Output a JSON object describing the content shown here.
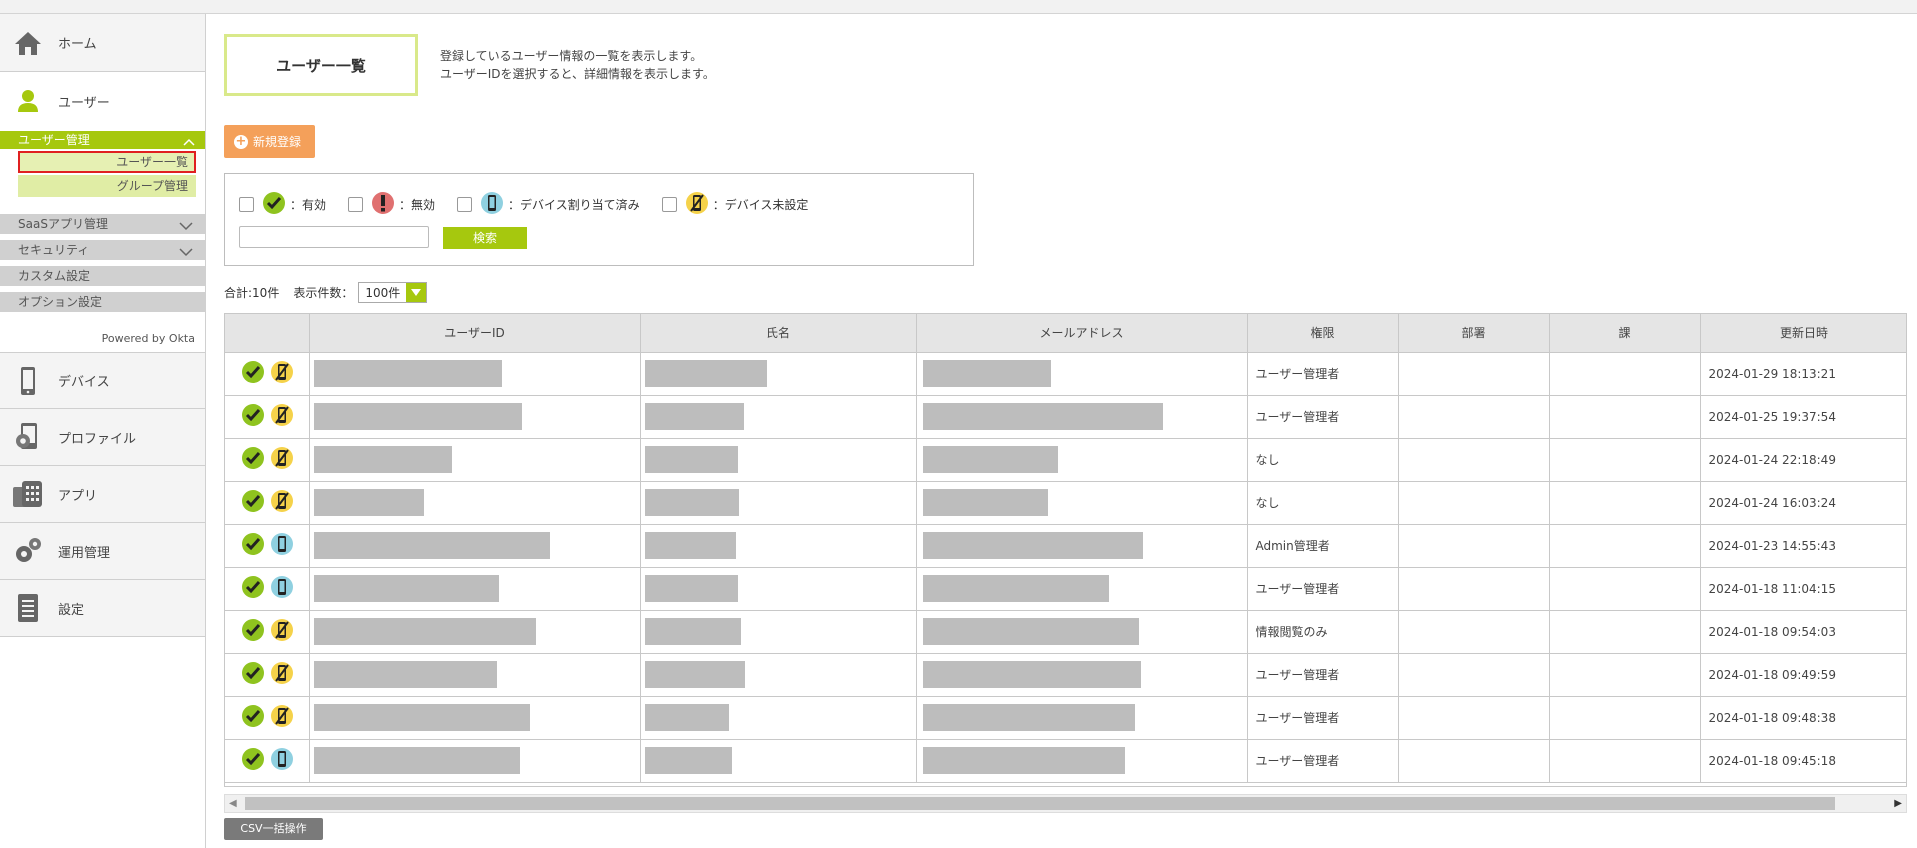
{
  "sidebar": {
    "home": "ホーム",
    "user": "ユーザー",
    "user_mgmt": "ユーザー管理",
    "user_list": "ユーザー一覧",
    "group_mgmt": "グループ管理",
    "saas": "SaaSアプリ管理",
    "security": "セキュリティ",
    "custom": "カスタム設定",
    "option": "オプション設定",
    "powered": "Powered by Okta",
    "device": "デバイス",
    "profile": "プロファイル",
    "app": "アプリ",
    "ops": "運用管理",
    "settings": "設定"
  },
  "header": {
    "title": "ユーザー一覧",
    "desc1": "登録しているユーザー情報の一覧を表示します。",
    "desc2": "ユーザーIDを選択すると、詳細情報を表示します。"
  },
  "new_button": "新規登録",
  "filters": {
    "active": "：有効",
    "inactive": "：無効",
    "assigned": "：デバイス割り当て済み",
    "unassigned": "：デバイス未設定",
    "search": "検索"
  },
  "summary": {
    "total": "合計:10件",
    "per_page_label": "表示件数：",
    "per_page": "100件"
  },
  "table": {
    "headers": [
      "",
      "ユーザーID",
      "氏名",
      "メールアドレス",
      "権限",
      "部署",
      "課",
      "更新日時"
    ],
    "rows": [
      {
        "device": "unassigned",
        "role": "ユーザー管理者",
        "updated": "2024-01-29 18:13:21"
      },
      {
        "device": "unassigned",
        "role": "ユーザー管理者",
        "updated": "2024-01-25 19:37:54"
      },
      {
        "device": "unassigned",
        "role": "なし",
        "updated": "2024-01-24 22:18:49"
      },
      {
        "device": "unassigned",
        "role": "なし",
        "updated": "2024-01-24 16:03:24"
      },
      {
        "device": "assigned",
        "role": "Admin管理者",
        "updated": "2024-01-23 14:55:43"
      },
      {
        "device": "assigned",
        "role": "ユーザー管理者",
        "updated": "2024-01-18 11:04:15"
      },
      {
        "device": "unassigned",
        "role": "情報閲覧のみ",
        "updated": "2024-01-18 09:54:03"
      },
      {
        "device": "unassigned",
        "role": "ユーザー管理者",
        "updated": "2024-01-18 09:49:59"
      },
      {
        "device": "unassigned",
        "role": "ユーザー管理者",
        "updated": "2024-01-18 09:48:38"
      },
      {
        "device": "assigned",
        "role": "ユーザー管理者",
        "updated": "2024-01-18 09:45:18"
      }
    ]
  },
  "csv_button": "CSV一括操作",
  "colors": {
    "accent": "#a6c80e",
    "orange": "#f4a05a",
    "active_red_outline": "#e02020"
  }
}
